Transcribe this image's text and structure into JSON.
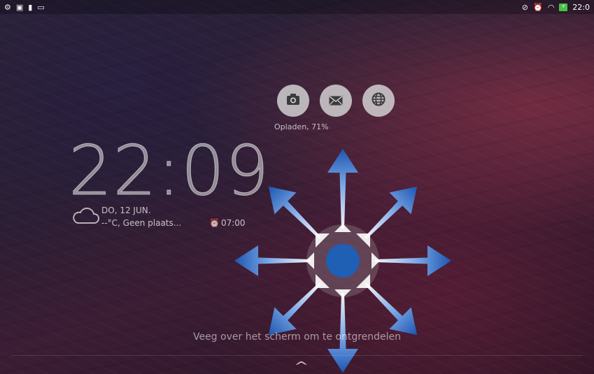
{
  "status_bar": {
    "left_icons": [
      "settings-icon",
      "image-icon",
      "file-icon",
      "card-icon"
    ],
    "right_icons": [
      "mute-icon",
      "alarm-icon",
      "wifi-icon",
      "battery-charging-icon"
    ],
    "time": "22:0"
  },
  "shortcuts": [
    {
      "name": "camera",
      "icon": "camera-icon",
      "glyph": "📷"
    },
    {
      "name": "email",
      "icon": "mail-icon",
      "glyph": "✉"
    },
    {
      "name": "browser",
      "icon": "globe-icon",
      "glyph": "🌐"
    }
  ],
  "charging_status": "Opladen, 71%",
  "clock": {
    "time": "22:09"
  },
  "date": "DO, 12 JUN.",
  "weather": "--°C, Geen plaats...",
  "alarm": {
    "glyph": "⏰",
    "time": "07:00"
  },
  "unlock_hint": "Veeg over het scherm om te ontgrendelen",
  "colors": {
    "arrow_blue": "#1f5fb4",
    "accent_green": "#47c146"
  }
}
